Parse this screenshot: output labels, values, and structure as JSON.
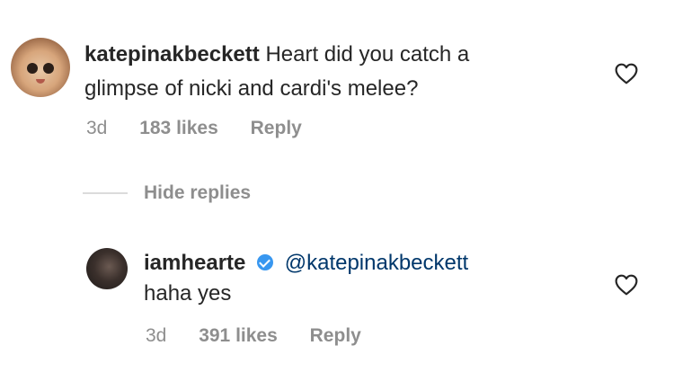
{
  "comment": {
    "username": "katepinakbeckett",
    "text_line1": "Heart did you catch a",
    "text_line2": "glimpse of nicki and cardi's melee?",
    "time": "3d",
    "likes": "183 likes",
    "reply": "Reply"
  },
  "hide_replies": "Hide replies",
  "reply_comment": {
    "username": "iamhearte",
    "mention": "@katepinakbeckett",
    "text": "haha yes",
    "time": "3d",
    "likes": "391 likes",
    "reply": "Reply"
  },
  "icons": {
    "like": "heart-outline-icon",
    "verified": "verified-badge-icon"
  }
}
